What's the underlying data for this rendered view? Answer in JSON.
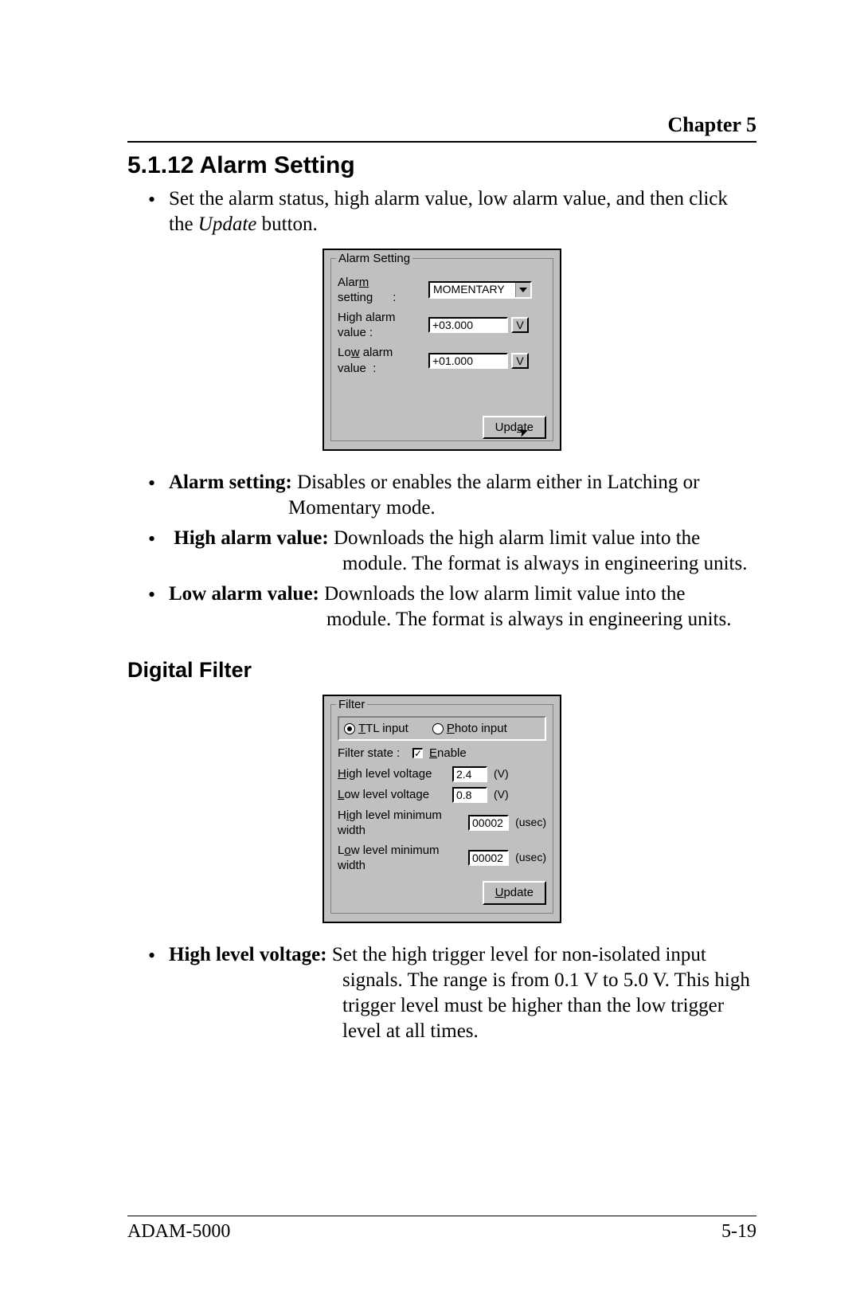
{
  "header": {
    "chapter": "Chapter 5"
  },
  "section": {
    "number_title": "5.1.12 Alarm Setting",
    "intro_pre": "Set the alarm status, high alarm value, low alarm value, and then click the ",
    "intro_italic": "Update",
    "intro_post": " button."
  },
  "alarm_dialog": {
    "group_title": "Alarm Setting",
    "rows": {
      "setting": {
        "label": "Alarm setting       :",
        "label_u": "m",
        "value": "MOMENTARY"
      },
      "high": {
        "label": "High alarm value  :",
        "label_u": "g",
        "value": "+03.000",
        "unit": "V"
      },
      "low": {
        "label": "Low alarm value   :",
        "label_u": "w",
        "value": "+01.000",
        "unit": "V"
      }
    },
    "button": "Update",
    "button_u": "a"
  },
  "definitions": [
    {
      "term": "Alarm setting:",
      "first": " Disables or enables the alarm either in Latching or",
      "cont": "Momentary mode.",
      "pad": "150px"
    },
    {
      "term": "High alarm value:",
      "first": "  Downloads the high alarm limit value into the",
      "cont": "module. The format is always in engineering units.",
      "pad": "218px"
    },
    {
      "term": "Low alarm value:",
      "first": " Downloads the low alarm limit value into the",
      "cont": "module. The format is always in engineering units.",
      "pad": "194px"
    }
  ],
  "digital_filter": {
    "heading": "Digital Filter",
    "dialog": {
      "group_title": "Filter",
      "radios": {
        "ttl": "TTL input",
        "photo": "Photo input"
      },
      "filter_state": {
        "label": "Filter state :",
        "check": "✓",
        "check_label": "Enable"
      },
      "rows": {
        "hlv": {
          "label": "High level voltage",
          "value": "2.4",
          "unit": "(V)"
        },
        "llv": {
          "label": "Low level voltage",
          "value": "0.8",
          "unit": "(V)"
        },
        "hlmw": {
          "label": "High level minimum width",
          "value": "00002",
          "unit": "(usec)"
        },
        "llmw": {
          "label": "Low level minimum width",
          "value": "00002",
          "unit": "(usec)"
        }
      },
      "button": "Update"
    },
    "def": {
      "term": "High level voltage:",
      "first": "  Set the high trigger level for non-isolated input",
      "cont": "signals. The range is from 0.1 V to 5.0 V. This high trigger level must be higher than the low trigger level at all times.",
      "pad": "218px"
    }
  },
  "footer": {
    "left": "ADAM-5000",
    "right": "5-19"
  }
}
